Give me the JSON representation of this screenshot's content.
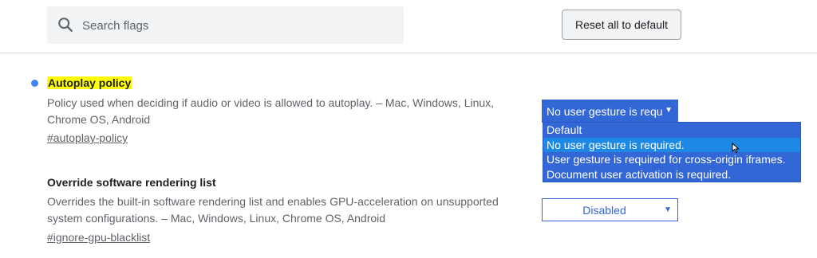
{
  "header": {
    "search_placeholder": "Search flags",
    "reset_label": "Reset all to default",
    "search_icon": "search-icon"
  },
  "colors": {
    "accent": "#3367d6",
    "highlight": "#ffff00",
    "dot": "#4285f4"
  },
  "flags": [
    {
      "title": "Autoplay policy",
      "description": "Policy used when deciding if audio or video is allowed to autoplay. – Mac, Windows, Linux, Chrome OS, Android",
      "link": "#autoplay-policy",
      "select_value": "No user gesture is required.",
      "options": [
        "Default",
        "No user gesture is required.",
        "User gesture is required for cross-origin iframes.",
        "Document user activation is required."
      ],
      "selected_index": 1
    },
    {
      "title": "Override software rendering list",
      "description": "Overrides the built-in software rendering list and enables GPU-acceleration on unsupported system configurations. – Mac, Windows, Linux, Chrome OS, Android",
      "link": "#ignore-gpu-blacklist",
      "select_value": "Disabled"
    }
  ]
}
